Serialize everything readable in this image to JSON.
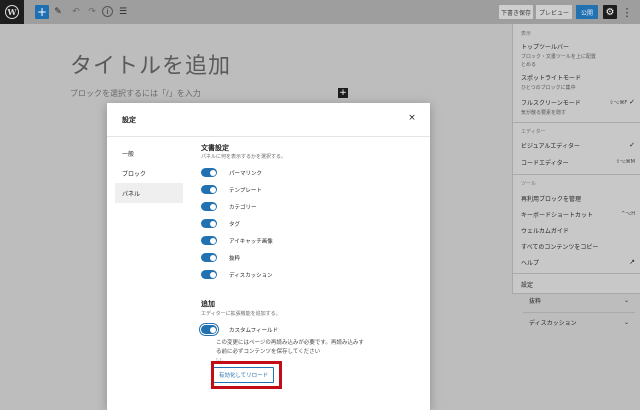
{
  "toolbar": {
    "add": "+",
    "edit": "✎",
    "undo": "↶",
    "redo": "↷",
    "info": "i",
    "list": "☰",
    "save_draft": "下書き保存",
    "preview": "プレビュー",
    "publish": "公開",
    "settings": "⚙",
    "more": "⋮"
  },
  "editor": {
    "title_placeholder": "タイトルを追加",
    "block_hint": "ブロックを選択するには「/」を入力",
    "block_add": "+"
  },
  "menu": {
    "view_section": "表示",
    "top_toolbar": "トップツールバー",
    "top_toolbar_desc1": "ブロック・文書ツールを上に配置",
    "top_toolbar_desc2": "とめる",
    "spotlight": "スポットライトモード",
    "spotlight_desc": "ひとつのブロックに集中",
    "fullscreen": "フルスクリーンモード",
    "fullscreen_desc": "気が散る要素を隠す",
    "fullscreen_shortcut": "⇧⌥⌘F",
    "check": "✓",
    "editor_section": "エディター",
    "visual_editor": "ビジュアルエディター",
    "code_editor": "コードエディター",
    "code_editor_shortcut": "⇧⌥⌘M",
    "tools_section": "ツール",
    "manage_blocks": "再利用ブロックを管理",
    "keyboard_shortcuts": "キーボードショートカット",
    "keyboard_shortcuts_key": "^⌥H",
    "welcome_guide": "ウェルカムガイド",
    "copy_all": "すべてのコンテンツをコピー",
    "help": "ヘルプ",
    "help_icon": "↗",
    "settings": "設定"
  },
  "sidebar": {
    "excerpt": "抜粋",
    "discussion": "ディスカッション",
    "chevron": "⌄"
  },
  "modal": {
    "title": "設定",
    "close": "×",
    "nav": [
      "一般",
      "ブロック",
      "パネル"
    ],
    "doc_settings_title": "文書設定",
    "doc_settings_desc": "パネルに何を表示するかを選択する。",
    "toggles": [
      "パーマリンク",
      "テンプレート",
      "カテゴリー",
      "タグ",
      "アイキャッチ画像",
      "抜粋",
      "ディスカッション"
    ],
    "additional_title": "追加",
    "additional_desc": "エディターに拡張機能を追加する。",
    "custom_fields": "カスタムフィールド",
    "custom_fields_note": "この変更にはページの再読み込みが必要です。再読み込みする前に必ずコンテンツを保存してください",
    "custom_fields_note_cut": "い。",
    "reload_button": "有効化してリロード"
  },
  "colors": {
    "accent": "#2271b1",
    "highlight": "#c30d16"
  }
}
